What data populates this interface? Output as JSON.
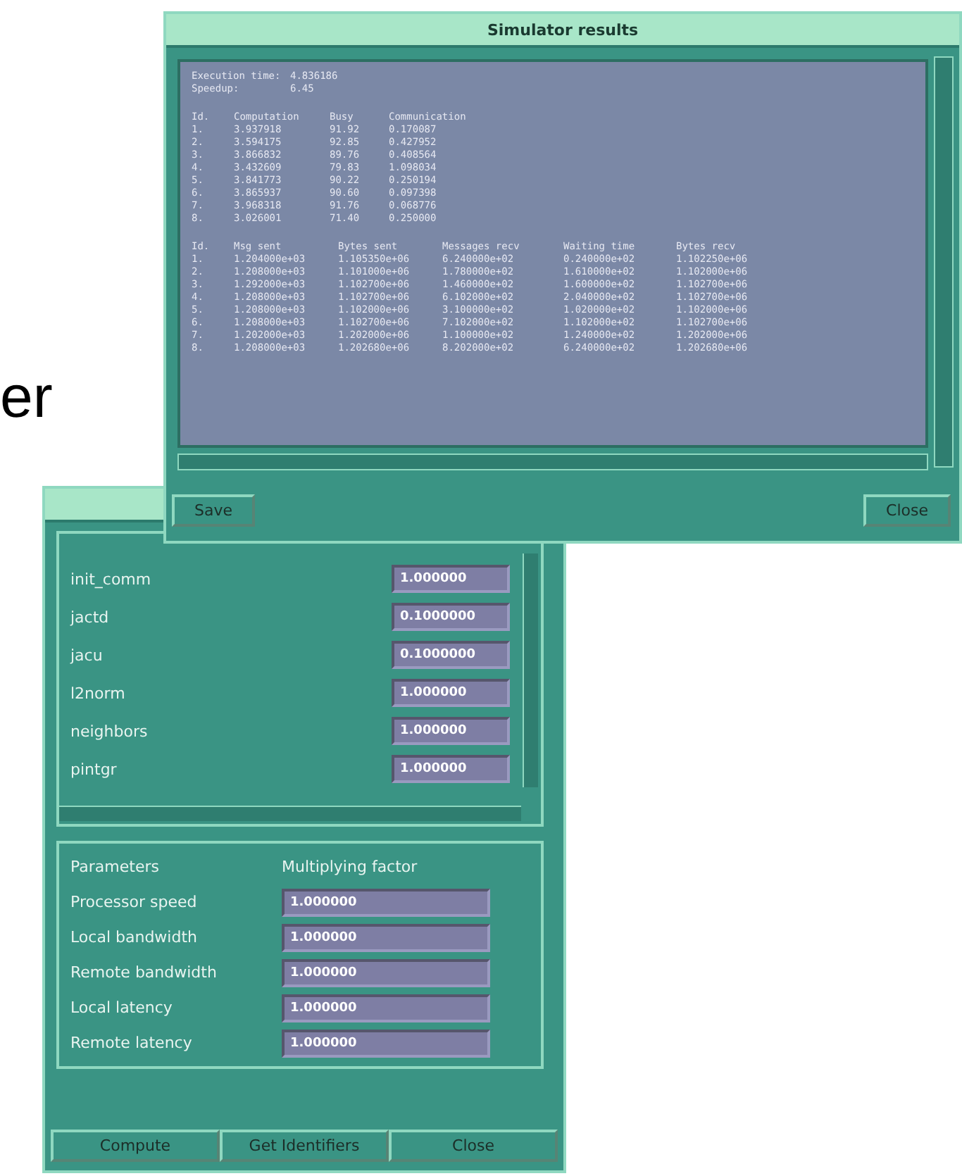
{
  "background_text": "er",
  "results_window": {
    "title": "Simulator results",
    "summary": [
      {
        "label": "Execution time:",
        "value": "4.836186"
      },
      {
        "label": "Speedup:",
        "value": "6.45"
      }
    ],
    "table_1": {
      "columns": [
        "Id.",
        "Computation",
        "Busy",
        "Communication"
      ],
      "rows": [
        [
          "1.",
          "3.937918",
          "91.92",
          "0.170087"
        ],
        [
          "2.",
          "3.594175",
          "92.85",
          "0.427952"
        ],
        [
          "3.",
          "3.866832",
          "89.76",
          "0.408564"
        ],
        [
          "4.",
          "3.432609",
          "79.83",
          "1.098034"
        ],
        [
          "5.",
          "3.841773",
          "90.22",
          "0.250194"
        ],
        [
          "6.",
          "3.865937",
          "90.60",
          "0.097398"
        ],
        [
          "7.",
          "3.968318",
          "91.76",
          "0.068776"
        ],
        [
          "8.",
          "3.026001",
          "71.40",
          "0.250000"
        ]
      ]
    },
    "table_2": {
      "columns": [
        "Id.",
        "Msg sent",
        "Bytes sent",
        "Messages recv",
        "Waiting time",
        "Bytes recv"
      ],
      "rows": [
        [
          "1.",
          "1.204000e+03",
          "1.105350e+06",
          "6.240000e+02",
          "0.240000e+02",
          "1.102250e+06"
        ],
        [
          "2.",
          "1.208000e+03",
          "1.101000e+06",
          "1.780000e+02",
          "1.610000e+02",
          "1.102000e+06"
        ],
        [
          "3.",
          "1.292000e+03",
          "1.102700e+06",
          "1.460000e+02",
          "1.600000e+02",
          "1.102700e+06"
        ],
        [
          "4.",
          "1.208000e+03",
          "1.102700e+06",
          "6.102000e+02",
          "2.040000e+02",
          "1.102700e+06"
        ],
        [
          "5.",
          "1.208000e+03",
          "1.102000e+06",
          "3.100000e+02",
          "1.020000e+02",
          "1.102000e+06"
        ],
        [
          "6.",
          "1.208000e+03",
          "1.102700e+06",
          "7.102000e+02",
          "1.102000e+02",
          "1.102700e+06"
        ],
        [
          "7.",
          "1.202000e+03",
          "1.202000e+06",
          "1.100000e+02",
          "1.240000e+02",
          "1.202000e+06"
        ],
        [
          "8.",
          "1.208000e+03",
          "1.202680e+06",
          "8.202000e+02",
          "6.240000e+02",
          "1.202680e+06"
        ]
      ]
    },
    "buttons": [
      "Save",
      "Close"
    ]
  },
  "parameters_window": {
    "identifiers": [
      {
        "name": "init_comm",
        "value": "1.000000"
      },
      {
        "name": "jactd",
        "value": "0.1000000"
      },
      {
        "name": "jacu",
        "value": "0.1000000"
      },
      {
        "name": "l2norm",
        "value": "1.000000"
      },
      {
        "name": "neighbors",
        "value": "1.000000"
      },
      {
        "name": "pintgr",
        "value": "1.000000"
      }
    ],
    "parameters_header": {
      "name": "Parameters",
      "factor": "Multiplying factor"
    },
    "parameters": [
      {
        "name": "Processor speed",
        "value": "1.000000"
      },
      {
        "name": "Local bandwidth",
        "value": "1.000000"
      },
      {
        "name": "Remote bandwidth",
        "value": "1.000000"
      },
      {
        "name": "Local latency",
        "value": "1.000000"
      },
      {
        "name": "Remote latency",
        "value": "1.000000"
      }
    ],
    "buttons": [
      "Compute",
      "Get Identifiers",
      "Close"
    ]
  }
}
